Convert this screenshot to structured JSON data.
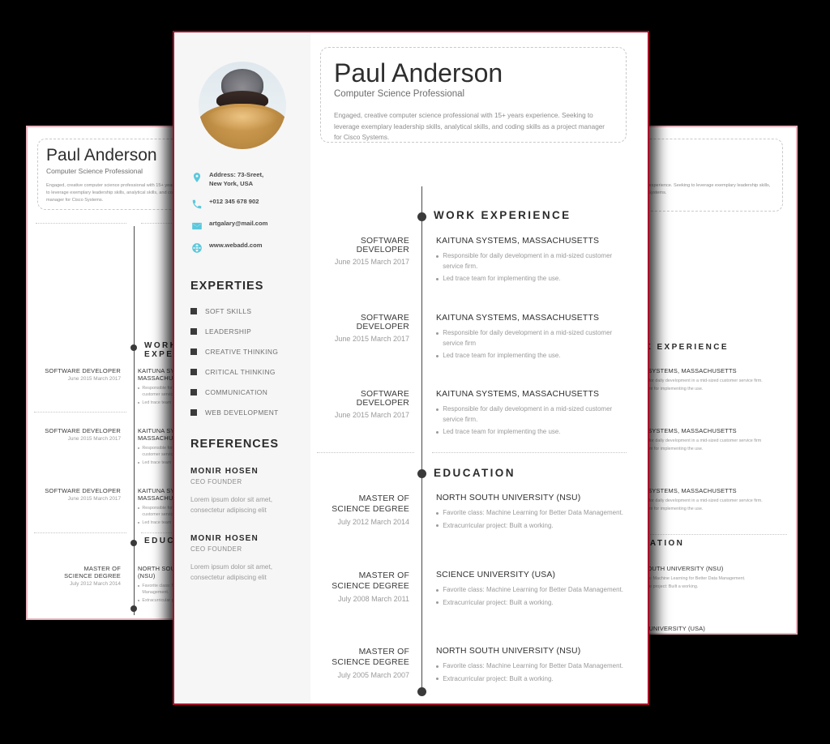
{
  "theme": {
    "page_background": "#000000",
    "card_background": "#ffffff",
    "sidebar_background": "#f6f6f6",
    "main_card_border": "#a8102a",
    "side_card_border": "#e8b3bd",
    "icon_accent": "#5bc8dc",
    "heading_color": "#2b2b2b",
    "body_text_color": "#9a9a9a"
  },
  "resume": {
    "header": {
      "name": "Paul Anderson",
      "role": "Computer Science Professional",
      "summary": "Engaged, creative computer science professional with 15+ years experience. Seeking to leverage exemplary leadership skills, analytical skills, and coding skills as a project manager for Cisco Systems."
    },
    "contact": [
      {
        "icon": "location-pin-icon",
        "text": "Address: 73-Sreet,\nNew York, USA"
      },
      {
        "icon": "phone-icon",
        "text": "+012 345 678 902"
      },
      {
        "icon": "envelope-icon",
        "text": "artgalary@mail.com"
      },
      {
        "icon": "globe-icon",
        "text": "www.webadd.com"
      }
    ],
    "experties": {
      "heading": "EXPERTIES",
      "items": [
        "SOFT SKILLS",
        "LEADERSHIP",
        "CREATIVE THINKING",
        "CRITICAL THINKING",
        "COMMUNICATION",
        "WEB DEVELOPMENT"
      ]
    },
    "references": {
      "heading": "REFERENCES",
      "items": [
        {
          "name": "MONIR HOSEN",
          "role": "CEO FOUNDER",
          "text": "Lorem ipsum dolor sit amet, consectetur adipiscing elit"
        },
        {
          "name": "MONIR HOSEN",
          "role": "CEO FOUNDER",
          "text": "Lorem ipsum dolor sit amet, consectetur adipiscing elit"
        }
      ]
    },
    "work_experience": {
      "heading": "WORK EXPERIENCE",
      "entries": [
        {
          "title": "SOFTWARE DEVELOPER",
          "date": "June 2015 March 2017",
          "org": "KAITUNA SYSTEMS, MASSACHUSETTS",
          "bullets": [
            "Responsible for daily development in a mid-sized customer service firm.",
            "Led trace team for implementing the use."
          ]
        },
        {
          "title": "SOFTWARE DEVELOPER",
          "date": "June 2015 March 2017",
          "org": "KAITUNA SYSTEMS, MASSACHUSETTS",
          "bullets": [
            "Responsible for daily development in a mid-sized customer service firm",
            "Led trace team for implementing the use."
          ]
        },
        {
          "title": "SOFTWARE DEVELOPER",
          "date": "June 2015 March 2017",
          "org": "KAITUNA SYSTEMS, MASSACHUSETTS",
          "bullets": [
            "Responsible for daily development in a mid-sized customer service firm.",
            "Led trace team for implementing the use."
          ]
        }
      ]
    },
    "education": {
      "heading": "EDUCATION",
      "entries": [
        {
          "title": "MASTER OF\nSCIENCE DEGREE",
          "date": "July 2012 March 2014",
          "org": "NORTH SOUTH UNIVERSITY (NSU)",
          "bullets": [
            "Favorite class: Machine Learning for Better Data Management.",
            "Extracurricular project: Built a working."
          ]
        },
        {
          "title": "MASTER OF\nSCIENCE DEGREE",
          "date": "July 2008 March 2011",
          "org": "SCIENCE UNIVERSITY (USA)",
          "bullets": [
            "Favorite class: Machine Learning for Better Data Management.",
            "Extracurricular project: Built a working."
          ]
        },
        {
          "title": "MASTER OF\nSCIENCE DEGREE",
          "date": "July 2005 March 2007",
          "org": "NORTH SOUTH UNIVERSITY (NSU)",
          "bullets": [
            "Favorite class: Machine Learning for Better Data Management.",
            "Extracurricular project: Built a working."
          ]
        }
      ]
    }
  }
}
